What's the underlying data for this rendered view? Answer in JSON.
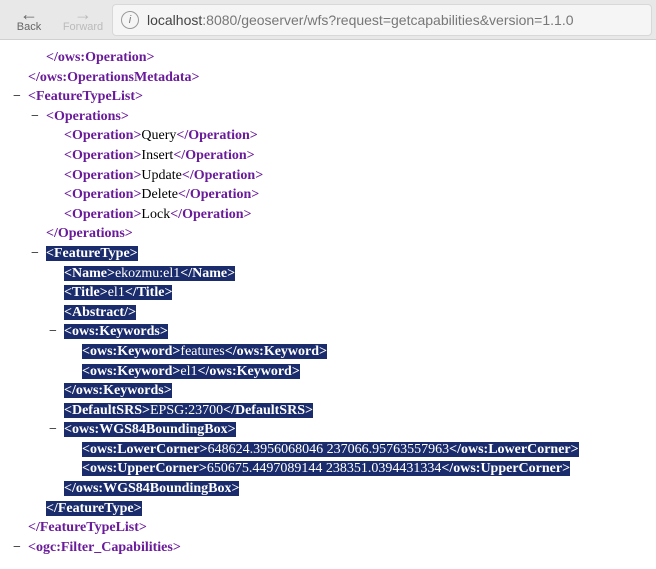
{
  "toolbar": {
    "back": "Back",
    "forward": "Forward",
    "url_host": "localhost",
    "url_path": ":8080/geoserver/wfs?request=getcapabilities&version=1.1.0"
  },
  "xml": {
    "owsOperation": "ows:Operation",
    "owsOperationsMetadata": "ows:OperationsMetadata",
    "featureTypeList": "FeatureTypeList",
    "operations": "Operations",
    "operation": "Operation",
    "op_query": "Query",
    "op_insert": "Insert",
    "op_update": "Update",
    "op_delete": "Delete",
    "op_lock": "Lock",
    "featureType": "FeatureType",
    "name": "Name",
    "name_val": "ekozmu:el1",
    "title": "Title",
    "title_val": "el1",
    "abstract": "Abstract",
    "owsKeywords": "ows:Keywords",
    "owsKeyword": "ows:Keyword",
    "kw1": "features",
    "kw2": "el1",
    "defaultSRS": "DefaultSRS",
    "defaultSRS_val": "EPSG:23700",
    "wgs84bbox": "ows:WGS84BoundingBox",
    "lowerCorner": "ows:LowerCorner",
    "lowerCorner_val": "648624.3956068046 237066.95763557963",
    "upperCorner": "ows:UpperCorner",
    "upperCorner_val": "650675.4497089144 238351.0394431334",
    "filterCaps": "ogc:Filter_Capabilities"
  }
}
